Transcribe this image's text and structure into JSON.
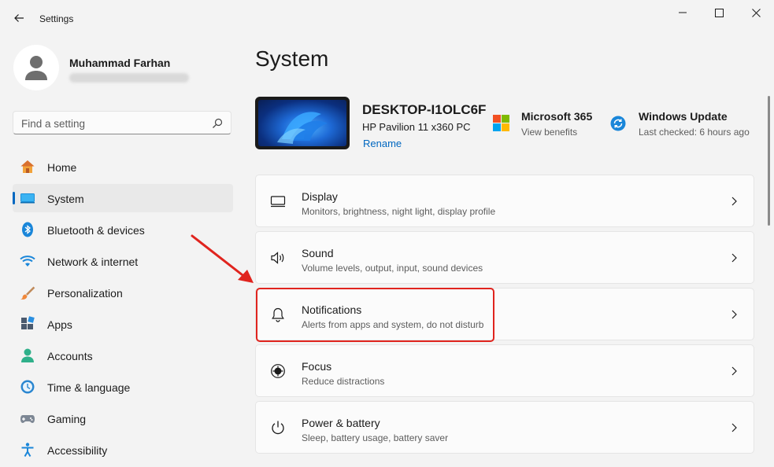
{
  "window": {
    "title": "Settings"
  },
  "profile": {
    "name": "Muhammad Farhan"
  },
  "search": {
    "placeholder": "Find a setting"
  },
  "nav": {
    "items": [
      {
        "label": "Home",
        "icon": "home-icon"
      },
      {
        "label": "System",
        "icon": "system-icon",
        "selected": true
      },
      {
        "label": "Bluetooth & devices",
        "icon": "bluetooth-icon"
      },
      {
        "label": "Network & internet",
        "icon": "wifi-icon"
      },
      {
        "label": "Personalization",
        "icon": "brush-icon"
      },
      {
        "label": "Apps",
        "icon": "apps-icon"
      },
      {
        "label": "Accounts",
        "icon": "accounts-icon"
      },
      {
        "label": "Time & language",
        "icon": "clock-globe-icon"
      },
      {
        "label": "Gaming",
        "icon": "gamepad-icon"
      },
      {
        "label": "Accessibility",
        "icon": "accessibility-icon"
      }
    ]
  },
  "main": {
    "title": "System",
    "device": {
      "name": "DESKTOP-I1OLC6F",
      "model": "HP Pavilion 11 x360 PC",
      "rename": "Rename"
    },
    "ms365": {
      "title": "Microsoft 365",
      "subtitle": "View benefits"
    },
    "windows_update": {
      "title": "Windows Update",
      "subtitle": "Last checked: 6 hours ago"
    },
    "cards": [
      {
        "title": "Display",
        "subtitle": "Monitors, brightness, night light, display profile",
        "icon": "monitor-icon"
      },
      {
        "title": "Sound",
        "subtitle": "Volume levels, output, input, sound devices",
        "icon": "speaker-icon"
      },
      {
        "title": "Notifications",
        "subtitle": "Alerts from apps and system, do not disturb",
        "icon": "bell-icon"
      },
      {
        "title": "Focus",
        "subtitle": "Reduce distractions",
        "icon": "focus-icon"
      },
      {
        "title": "Power & battery",
        "subtitle": "Sleep, battery usage, battery saver",
        "icon": "power-icon"
      }
    ]
  },
  "colors": {
    "accent": "#0067c0",
    "annotation": "#e0241e"
  }
}
